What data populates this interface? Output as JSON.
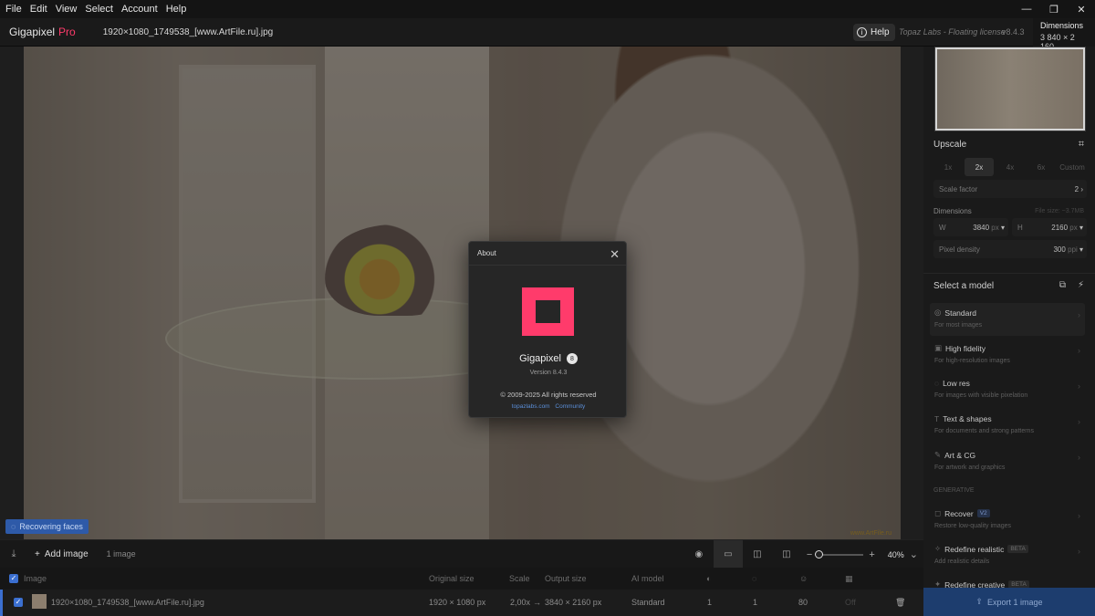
{
  "menu": [
    "File",
    "Edit",
    "View",
    "Select",
    "Account",
    "Help"
  ],
  "window_controls": {
    "minimize": "—",
    "restore": "❐",
    "close": "✕"
  },
  "app": {
    "name": "Gigapixel",
    "edition": "Pro"
  },
  "file_name": "1920×1080_1749538_[www.ArtFile.ru].jpg",
  "header": {
    "help": "Help",
    "license": "Topaz Labs - Floating license",
    "version": "v8.4.3",
    "dimensions_title": "Dimensions",
    "dimensions_value": "3 840 × 2 160"
  },
  "photo": {
    "watermark": "www.ArtFile.ru"
  },
  "status": {
    "recovering": "Recovering faces"
  },
  "toolbar": {
    "add_image": "Add image",
    "count": "1 image",
    "zoom": "40%"
  },
  "list": {
    "headers": {
      "image": "Image",
      "original": "Original size",
      "scale": "Scale",
      "output": "Output size",
      "model": "AI model"
    },
    "row": {
      "name": "1920×1080_1749538_[www.ArtFile.ru].jpg",
      "original": "1920 × 1080 px",
      "scale": "2,00x",
      "arrow": "→",
      "output": "3840 × 2160 px",
      "model": "Standard",
      "c1": "1",
      "c2": "1",
      "c3": "80",
      "c4": "Off"
    }
  },
  "upscale": {
    "title": "Upscale",
    "factors": [
      "1x",
      "2x",
      "4x",
      "6x",
      "Custom"
    ],
    "selected": "2x",
    "scale_factor_label": "Scale factor",
    "scale_factor_value": "2",
    "dimensions_label": "Dimensions",
    "file_size": "File size: ~3.7MB",
    "w_label": "W",
    "w_value": "3840",
    "w_unit": "px",
    "h_label": "H",
    "h_value": "2160",
    "h_unit": "px",
    "density_label": "Pixel density",
    "density_value": "300",
    "density_unit": "ppi"
  },
  "models": {
    "title": "Select a model",
    "items": [
      {
        "name": "Standard",
        "desc": "For most images"
      },
      {
        "name": "High fidelity",
        "desc": "For high-resolution images"
      },
      {
        "name": "Low res",
        "desc": "For images with visible pixelation"
      },
      {
        "name": "Text & shapes",
        "desc": "For documents and strong patterns"
      },
      {
        "name": "Art & CG",
        "desc": "For artwork and graphics"
      }
    ],
    "generative_label": "GENERATIVE",
    "gen_items": [
      {
        "name": "Recover",
        "tag": "V2",
        "desc": "Restore low-quality images"
      },
      {
        "name": "Redefine realistic",
        "tag": "BETA",
        "desc": "Add realistic details"
      },
      {
        "name": "Redefine creative",
        "tag": "BETA",
        "desc": ""
      }
    ]
  },
  "export": "Export 1 image",
  "about": {
    "title": "About",
    "app_name": "Gigapixel",
    "major": "8",
    "version": "Version 8.4.3",
    "copyright": "© 2009-2025 All rights reserved",
    "link1": "topazlabs.com",
    "link2": "Community"
  },
  "colors": {
    "accent": "#ff3b6b",
    "blue": "#3b6fd0"
  }
}
